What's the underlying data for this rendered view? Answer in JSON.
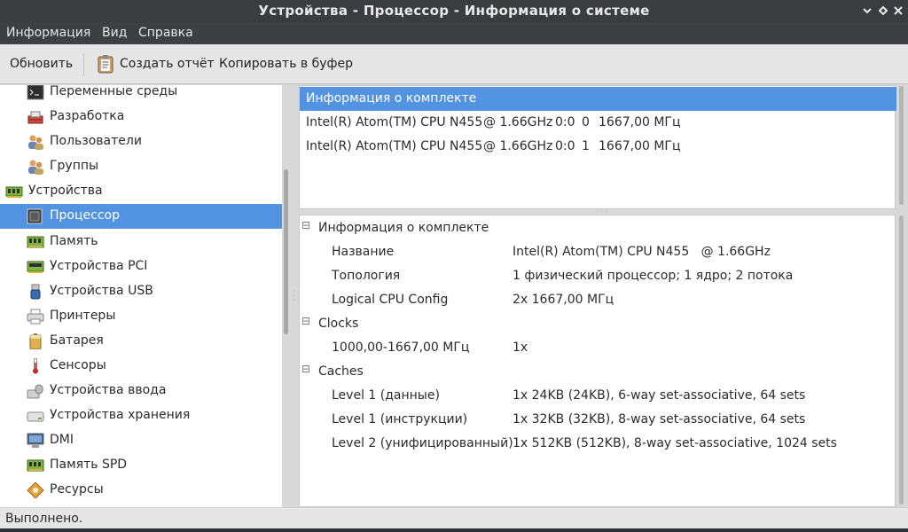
{
  "window": {
    "title": "Устройства - Процессор - Информация о системе"
  },
  "menubar": {
    "items": [
      "Информация",
      "Вид",
      "Справка"
    ]
  },
  "toolbar": {
    "refresh_label": "Обновить",
    "report_label": "Создать отчёт",
    "copy_label": "Копировать в буфер"
  },
  "sidebar": {
    "items": [
      {
        "label": "Переменные среды",
        "icon": "terminal-icon"
      },
      {
        "label": "Разработка",
        "icon": "development-icon"
      },
      {
        "label": "Пользователи",
        "icon": "users-icon"
      },
      {
        "label": "Группы",
        "icon": "groups-icon"
      },
      {
        "label": "Устройства",
        "icon": "devices-icon"
      },
      {
        "label": "Процессор",
        "icon": "processor-icon",
        "selected": true
      },
      {
        "label": "Память",
        "icon": "memory-icon"
      },
      {
        "label": "Устройства PCI",
        "icon": "pci-icon"
      },
      {
        "label": "Устройства USB",
        "icon": "usb-icon"
      },
      {
        "label": "Принтеры",
        "icon": "printer-icon"
      },
      {
        "label": "Батарея",
        "icon": "battery-icon"
      },
      {
        "label": "Сенсоры",
        "icon": "thermometer-icon"
      },
      {
        "label": "Устройства ввода",
        "icon": "input-devices-icon"
      },
      {
        "label": "Устройства хранения",
        "icon": "storage-icon"
      },
      {
        "label": "DMI",
        "icon": "dmi-icon"
      },
      {
        "label": "Память SPD",
        "icon": "spd-icon"
      },
      {
        "label": "Ресурсы",
        "icon": "resources-icon"
      }
    ]
  },
  "cpu_list": {
    "header": "Информация о комплекте",
    "rows": [
      {
        "model": "Intel(R) Atom(TM) CPU N455",
        "freq": "@ 1.66GHz",
        "pkg": "0:0",
        "core": "0",
        "mhz": "1667,00 МГц"
      },
      {
        "model": "Intel(R) Atom(TM) CPU N455",
        "freq": "@ 1.66GHz",
        "pkg": "0:0",
        "core": "1",
        "mhz": "1667,00 МГц"
      }
    ]
  },
  "details": {
    "groups": [
      {
        "title": "Информация о комплекте",
        "rows": [
          {
            "key": "Название",
            "value": "Intel(R) Atom(TM) CPU N455   @ 1.66GHz"
          },
          {
            "key": "Топология",
            "value": "1 физический процессор; 1 ядро; 2 потока"
          },
          {
            "key": "Logical CPU Config",
            "value": "2x 1667,00 МГц"
          }
        ]
      },
      {
        "title": "Clocks",
        "rows": [
          {
            "key": "1000,00-1667,00 МГц",
            "value": "1x"
          }
        ]
      },
      {
        "title": "Caches",
        "rows": [
          {
            "key": "Level 1 (данные)",
            "value": "1x 24KB (24KB), 6-way set-associative, 64 sets"
          },
          {
            "key": "Level 1 (инструкции)",
            "value": "1x 32KB (32KB), 8-way set-associative, 64 sets"
          },
          {
            "key": "Level 2 (унифицированный)",
            "value": "1x 512KB (512KB), 8-way set-associative, 1024 sets"
          }
        ]
      }
    ]
  },
  "status": {
    "text": "Выполнено."
  },
  "colors": {
    "selection": "#5294e2",
    "titlebar": "#3a3c3f"
  }
}
